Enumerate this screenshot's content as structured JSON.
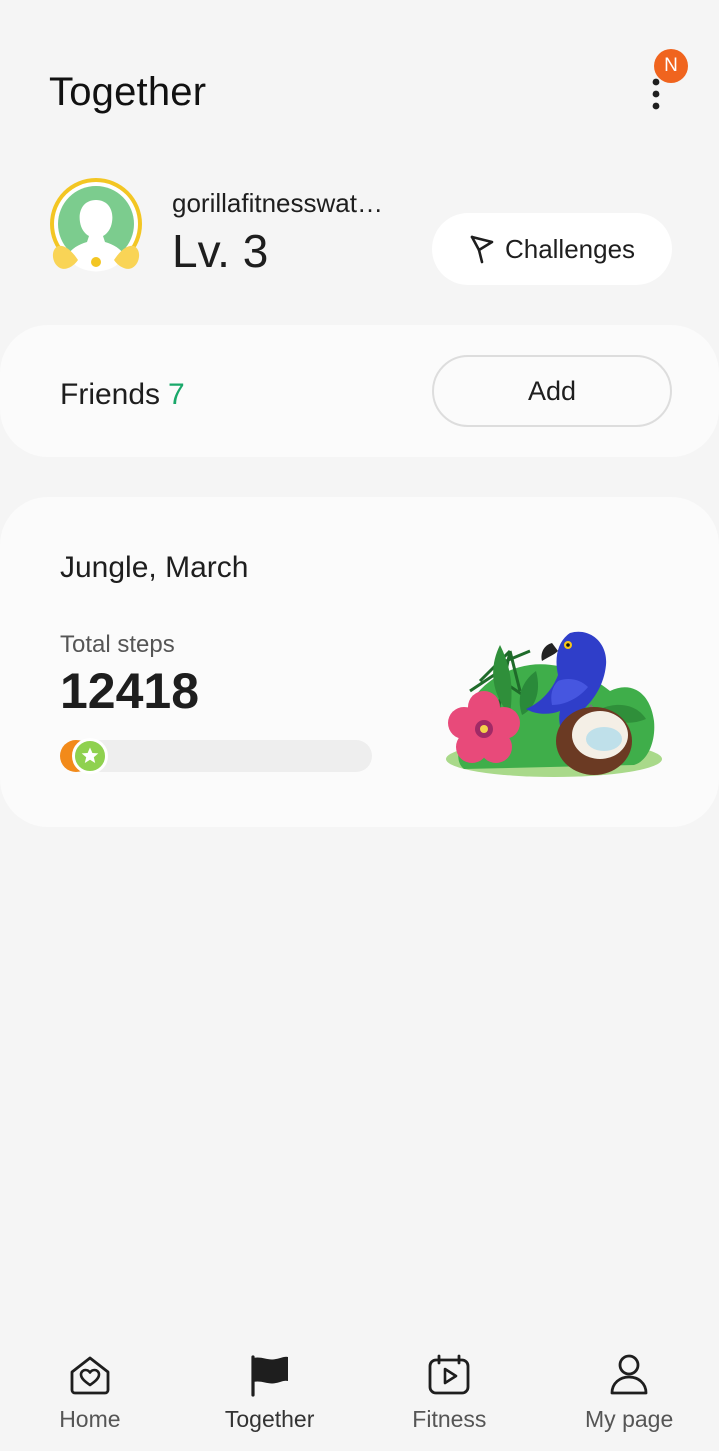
{
  "header": {
    "title": "Together",
    "notification_badge": "N"
  },
  "profile": {
    "username": "gorillafitnesswat…",
    "level": "Lv. 3",
    "challenges_label": "Challenges"
  },
  "friends": {
    "label": "Friends",
    "count": "7",
    "add_label": "Add"
  },
  "event": {
    "title": "Jungle, March",
    "steps_label": "Total steps",
    "steps_value": "12418",
    "progress_fraction": 0.08
  },
  "bottom_nav": {
    "items": [
      {
        "label": "Home",
        "icon": "home-heart-icon"
      },
      {
        "label": "Together",
        "icon": "flag-icon",
        "active": true
      },
      {
        "label": "Fitness",
        "icon": "calendar-play-icon"
      },
      {
        "label": "My page",
        "icon": "person-icon"
      }
    ]
  },
  "colors": {
    "accent_green": "#1aa86a",
    "badge_orange": "#f0641e",
    "progress_orange": "#f28a1a",
    "background": "#f5f5f5"
  }
}
